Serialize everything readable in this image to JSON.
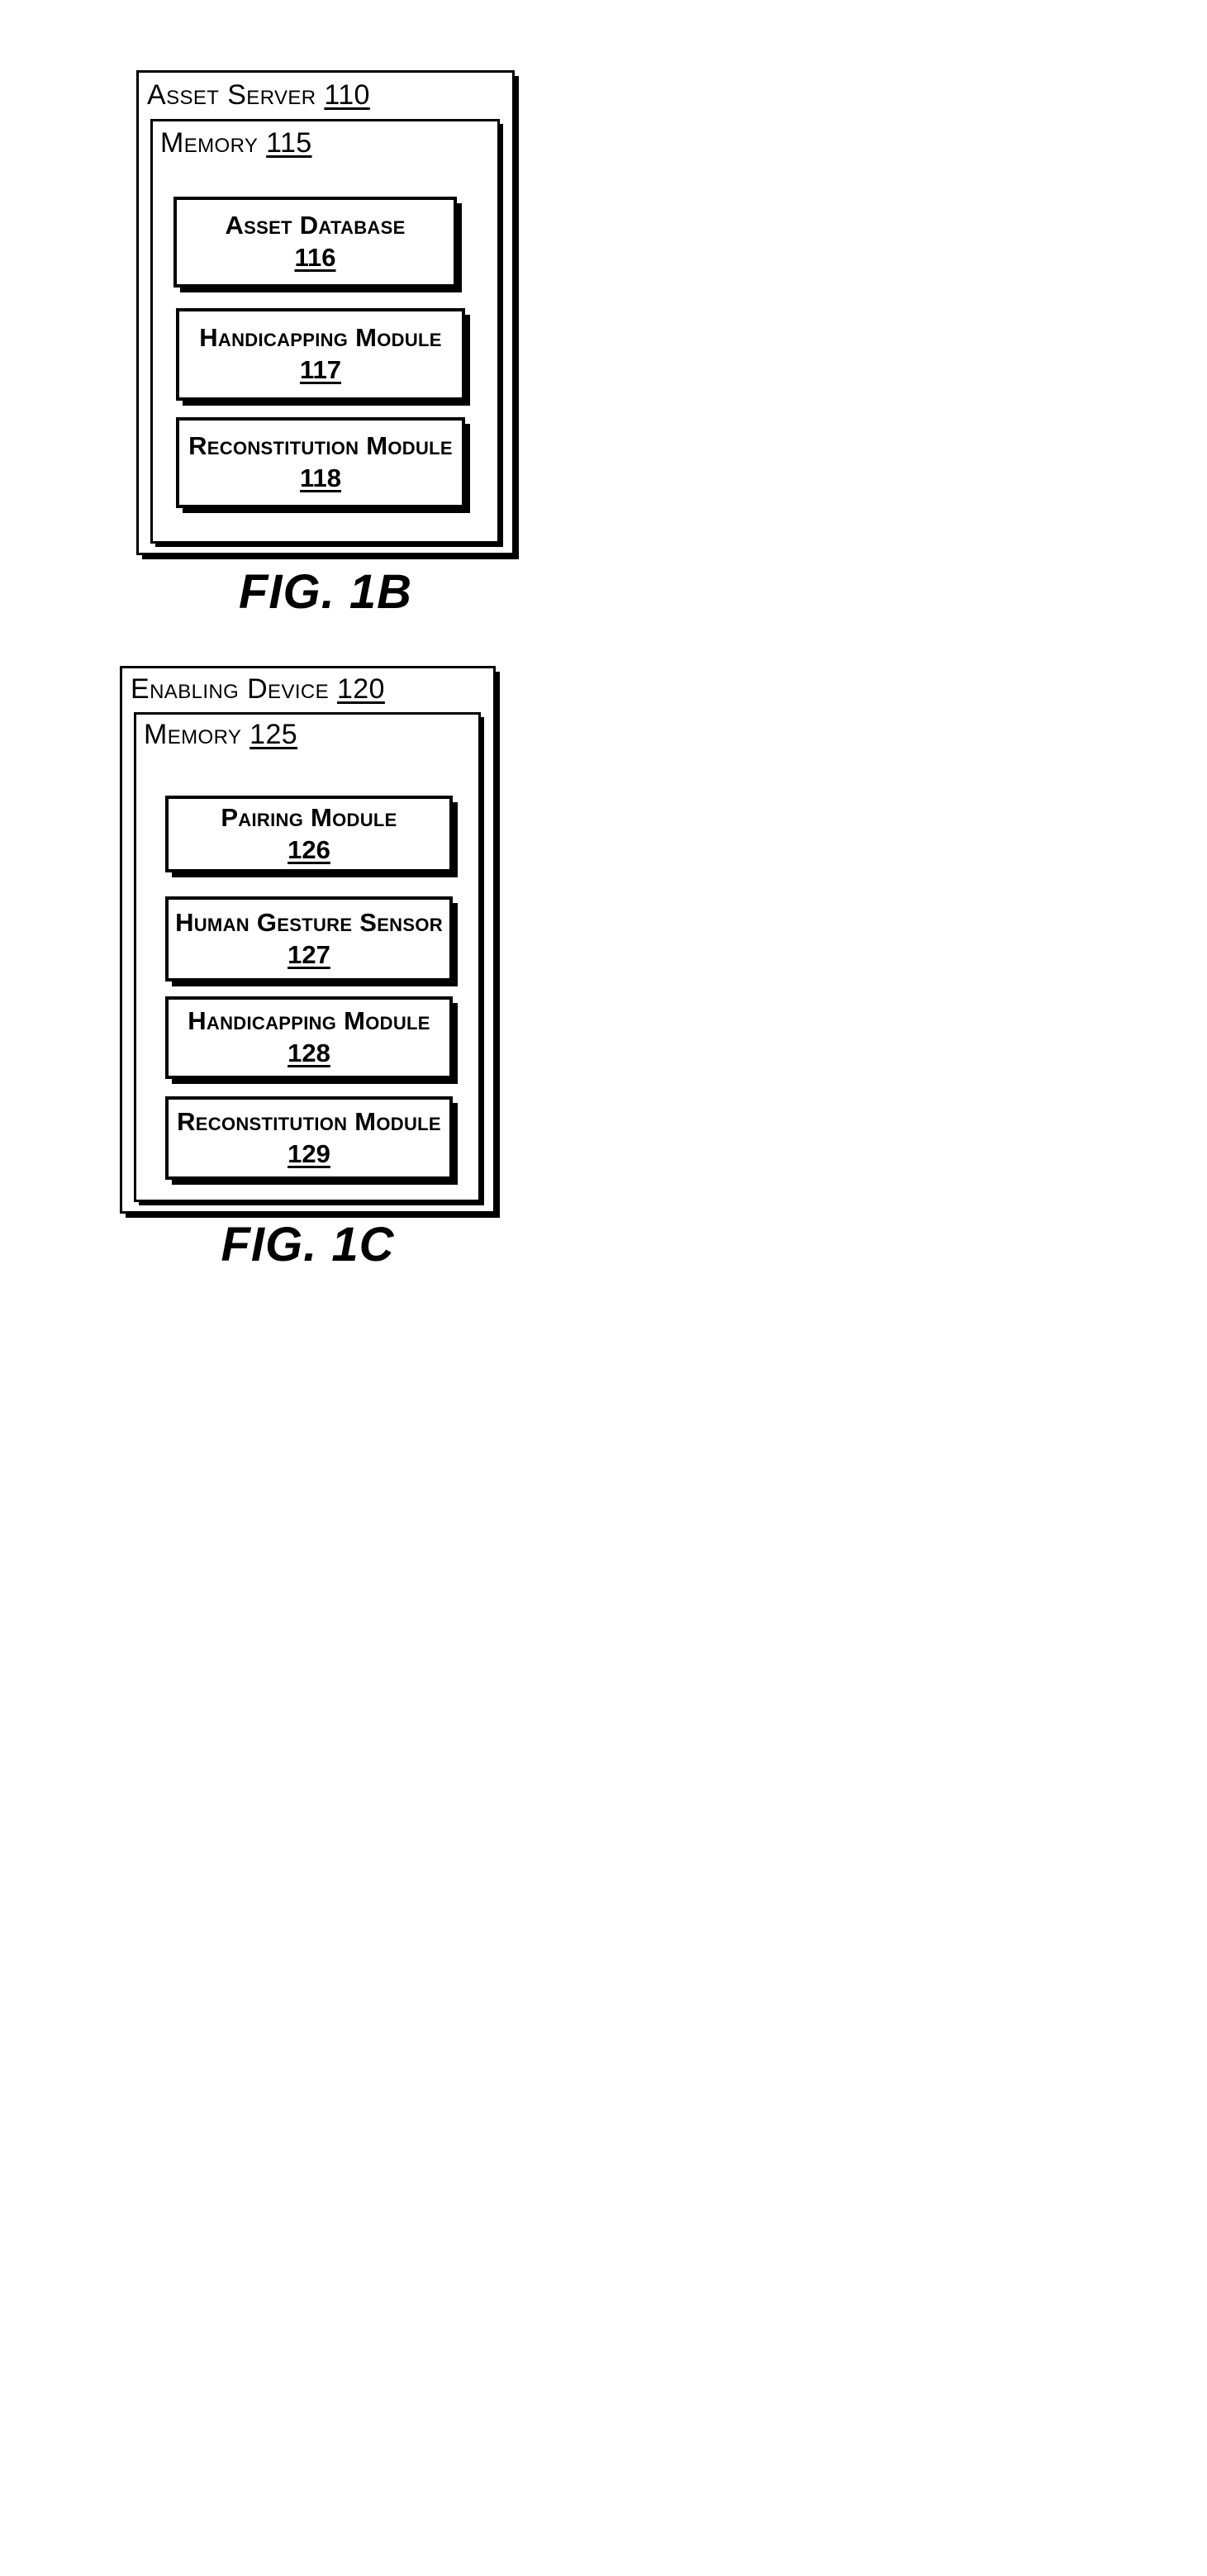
{
  "page": {
    "background_color": "#ffffff",
    "ink_color": "#000000"
  },
  "figures": [
    {
      "id": "fig-1b",
      "caption": "FIG. 1B",
      "outer": {
        "title": "Asset Server",
        "ref": "110"
      },
      "memory": {
        "title": "Memory",
        "ref": "115"
      },
      "modules": [
        {
          "title": "Asset Database",
          "ref": "116"
        },
        {
          "title": "Handicapping Module",
          "ref": "117"
        },
        {
          "title": "Reconstitution Module",
          "ref": "118"
        }
      ]
    },
    {
      "id": "fig-1c",
      "caption": "FIG. 1C",
      "outer": {
        "title": "Enabling Device",
        "ref": "120"
      },
      "memory": {
        "title": "Memory",
        "ref": "125"
      },
      "modules": [
        {
          "title": "Pairing Module",
          "ref": "126"
        },
        {
          "title": "Human Gesture Sensor",
          "ref": "127"
        },
        {
          "title": "Handicapping Module",
          "ref": "128"
        },
        {
          "title": "Reconstitution Module",
          "ref": "129"
        }
      ]
    }
  ]
}
